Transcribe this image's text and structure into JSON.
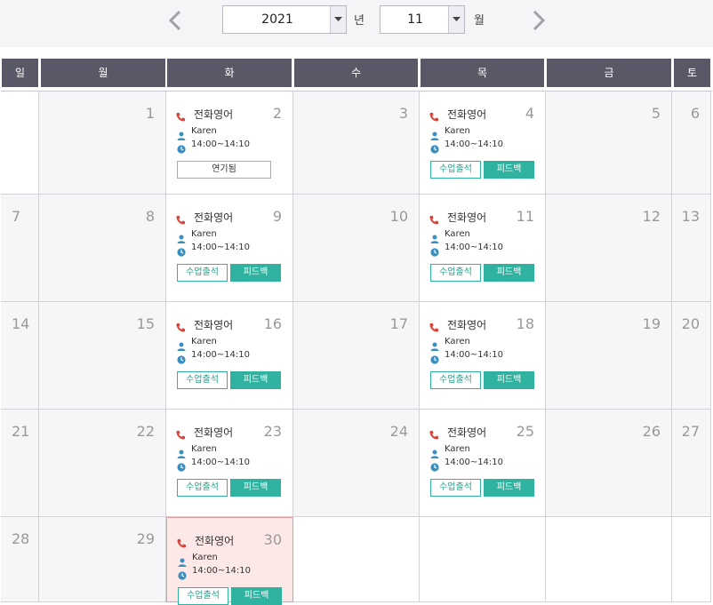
{
  "nav": {
    "prev_icon": "chevron-left-icon",
    "next_icon": "chevron-right-icon"
  },
  "year_select": {
    "value": "2021",
    "unit": "년"
  },
  "month_select": {
    "value": "11",
    "unit": "월"
  },
  "weekdays": [
    "일",
    "월",
    "화",
    "수",
    "목",
    "금",
    "토"
  ],
  "lesson": {
    "title": "전화영어",
    "teacher": "Karen",
    "time": "14:00~14:10",
    "attend_label": "수업출석",
    "feedback_label": "피드백",
    "postponed_label": "연기됨"
  },
  "weeks": [
    {
      "days": [
        "",
        "1",
        "2",
        "3",
        "4",
        "5",
        "6"
      ]
    },
    {
      "days": [
        "7",
        "8",
        "9",
        "10",
        "11",
        "12",
        "13"
      ]
    },
    {
      "days": [
        "14",
        "15",
        "16",
        "17",
        "18",
        "19",
        "20"
      ]
    },
    {
      "days": [
        "21",
        "22",
        "23",
        "24",
        "25",
        "26",
        "27"
      ]
    },
    {
      "days": [
        "28",
        "29",
        "30",
        "",
        "",
        "",
        ""
      ]
    }
  ],
  "colors": {
    "header_bg": "#585866",
    "accent": "#2fb29f",
    "phone": "#d9433a",
    "person": "#3a8fc1"
  }
}
